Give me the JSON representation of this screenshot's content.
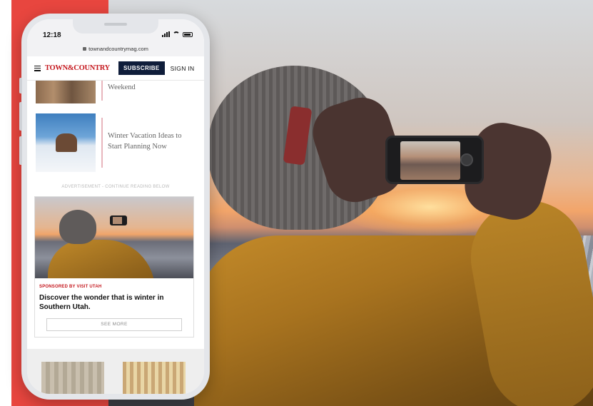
{
  "status_bar": {
    "time": "12:18"
  },
  "browser": {
    "url": "townandcountrymag.com"
  },
  "site_header": {
    "logo": "TOWN&COUNTRY",
    "subscribe_label": "SUBSCRIBE",
    "signin_label": "SIGN IN"
  },
  "articles": [
    {
      "title": "Weekend"
    },
    {
      "title": "Winter Vacation Ideas to Start Planning Now"
    }
  ],
  "ad": {
    "label": "ADVERTISEMENT - CONTINUE READING BELOW",
    "sponsor": "SPONSORED BY VISIT UTAH",
    "headline": "Discover the wonder that is winter in Southern Utah.",
    "cta": "SEE MORE"
  },
  "colors": {
    "brand_red": "#c4161c",
    "subscribe_navy": "#0f1d3a",
    "accent_band": "#e8463f"
  }
}
